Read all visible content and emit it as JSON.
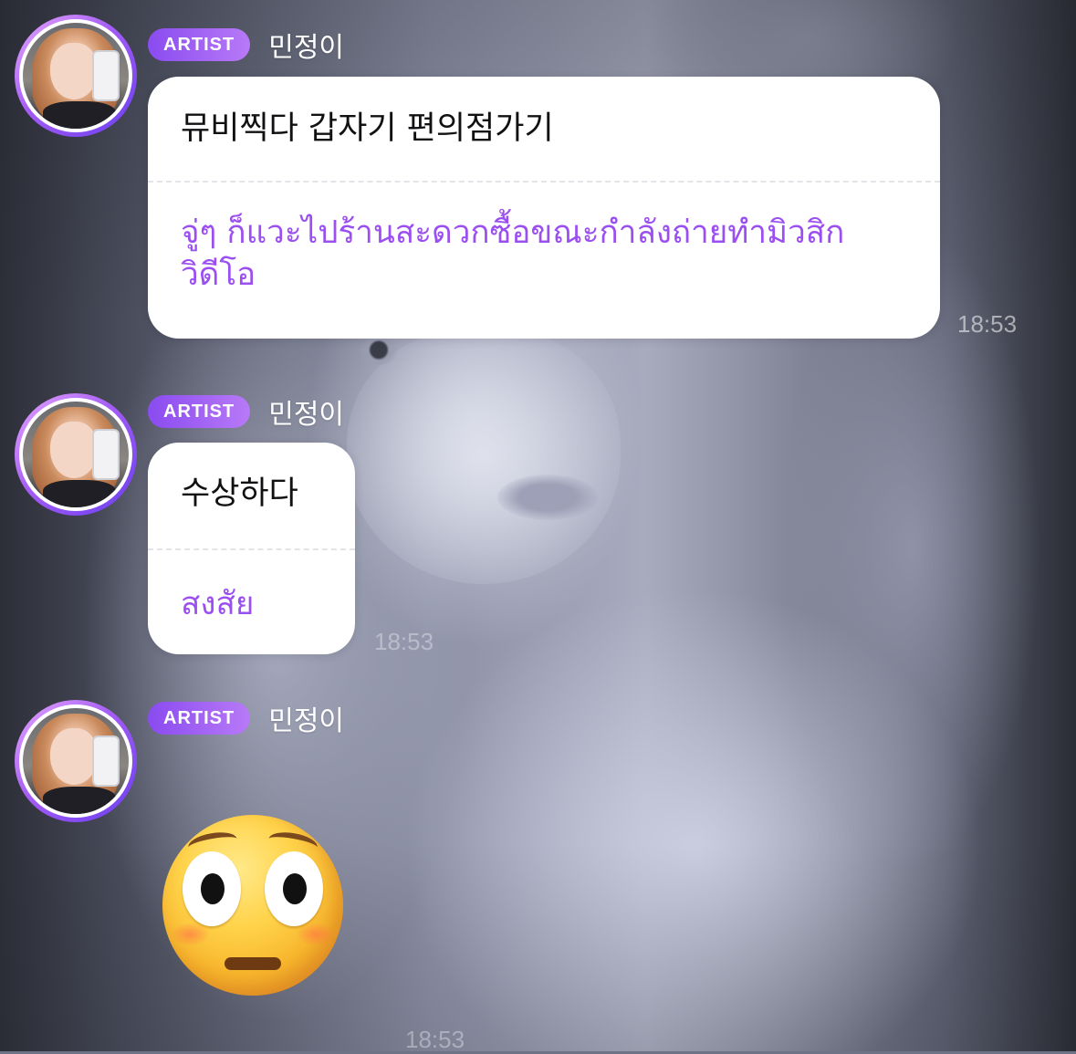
{
  "messages": [
    {
      "badge": "ARTIST",
      "sender": "민정이",
      "original": "뮤비찍다 갑자기 편의점가기",
      "translation": "จู่ๆ ก็แวะไปร้านสะดวกซื้อขณะกำลังถ่ายทำมิวสิกวิดีโอ",
      "time": "18:53"
    },
    {
      "badge": "ARTIST",
      "sender": "민정이",
      "original": "수상하다",
      "translation": "สงสัย",
      "time": "18:53"
    },
    {
      "badge": "ARTIST",
      "sender": "민정이",
      "emoji": "flushed-face",
      "time": "18:53"
    }
  ],
  "colors": {
    "badge_gradient_start": "#8a4bf0",
    "badge_gradient_end": "#b87af7",
    "translation_text": "#9b4ff1",
    "bubble_bg": "#ffffff"
  }
}
